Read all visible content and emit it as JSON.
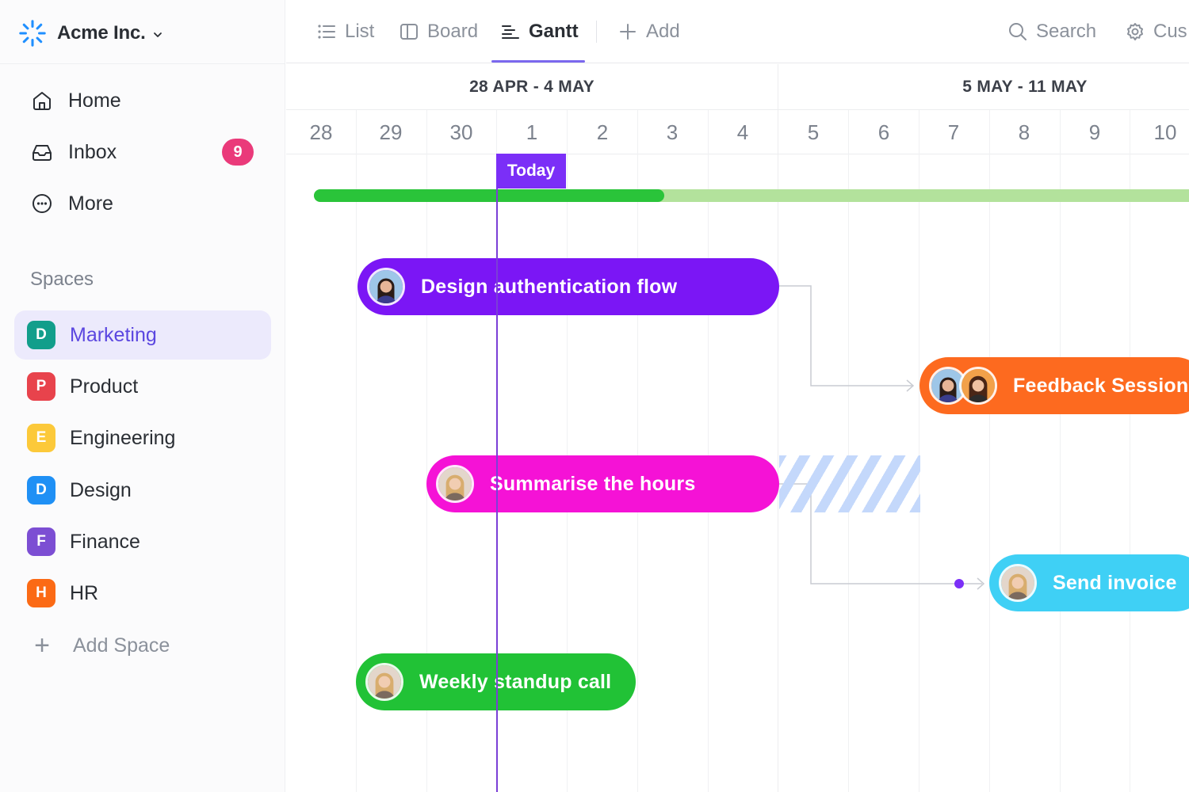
{
  "workspace": {
    "name": "Acme Inc.",
    "logo_icon": "asterisk-burst-logo",
    "logo_color": "#1f8fff"
  },
  "nav": [
    {
      "label": "Home",
      "icon": "home-icon"
    },
    {
      "label": "Inbox",
      "icon": "inbox-icon",
      "badge": "9"
    },
    {
      "label": "More",
      "icon": "more-icon"
    }
  ],
  "spaces": {
    "title": "Spaces",
    "items": [
      {
        "letter": "D",
        "label": "Marketing",
        "color": "#129e8b",
        "active": true
      },
      {
        "letter": "P",
        "label": "Product",
        "color": "#e8434c"
      },
      {
        "letter": "E",
        "label": "Engineering",
        "color": "#fcc93a"
      },
      {
        "letter": "D",
        "label": "Design",
        "color": "#1f90f5"
      },
      {
        "letter": "F",
        "label": "Finance",
        "color": "#7c4ed3"
      },
      {
        "letter": "H",
        "label": "HR",
        "color": "#fb6a15"
      }
    ],
    "add_label": "Add Space"
  },
  "topbar": {
    "tabs": [
      {
        "label": "List",
        "icon": "list-icon"
      },
      {
        "label": "Board",
        "icon": "board-icon"
      },
      {
        "label": "Gantt",
        "icon": "gantt-icon",
        "active": true
      }
    ],
    "add_label": "Add",
    "search_label": "Search",
    "customize_label": "Cus"
  },
  "gantt": {
    "weeks": [
      "28 APR - 4 MAY",
      "5 MAY - 11 MAY"
    ],
    "days": [
      "28",
      "29",
      "30",
      "1",
      "2",
      "3",
      "4",
      "5",
      "6",
      "7",
      "8",
      "9",
      "10"
    ],
    "today_label": "Today",
    "progress": 0.4,
    "tasks": [
      {
        "title": "Design authentication flow",
        "color": "#7b16f5",
        "avatars": [
          "avatar-woman-dark-hair"
        ]
      },
      {
        "title": "Feedback Session",
        "color": "#fd6a1f",
        "avatars": [
          "avatar-woman-dark-hair",
          "avatar-woman-brown-hair"
        ]
      },
      {
        "title": "Summarise the hours",
        "color": "#f512d6",
        "avatars": [
          "avatar-woman-blonde"
        ]
      },
      {
        "title": "Send invoice",
        "color": "#3fd0f5",
        "avatars": [
          "avatar-woman-blonde"
        ]
      },
      {
        "title": "Weekly standup call",
        "color": "#21c236",
        "avatars": [
          "avatar-woman-blonde"
        ]
      }
    ],
    "progress_colors": {
      "done": "#2ac43a",
      "remaining": "#b3e29c"
    },
    "today_color": "#7b2ff7"
  }
}
